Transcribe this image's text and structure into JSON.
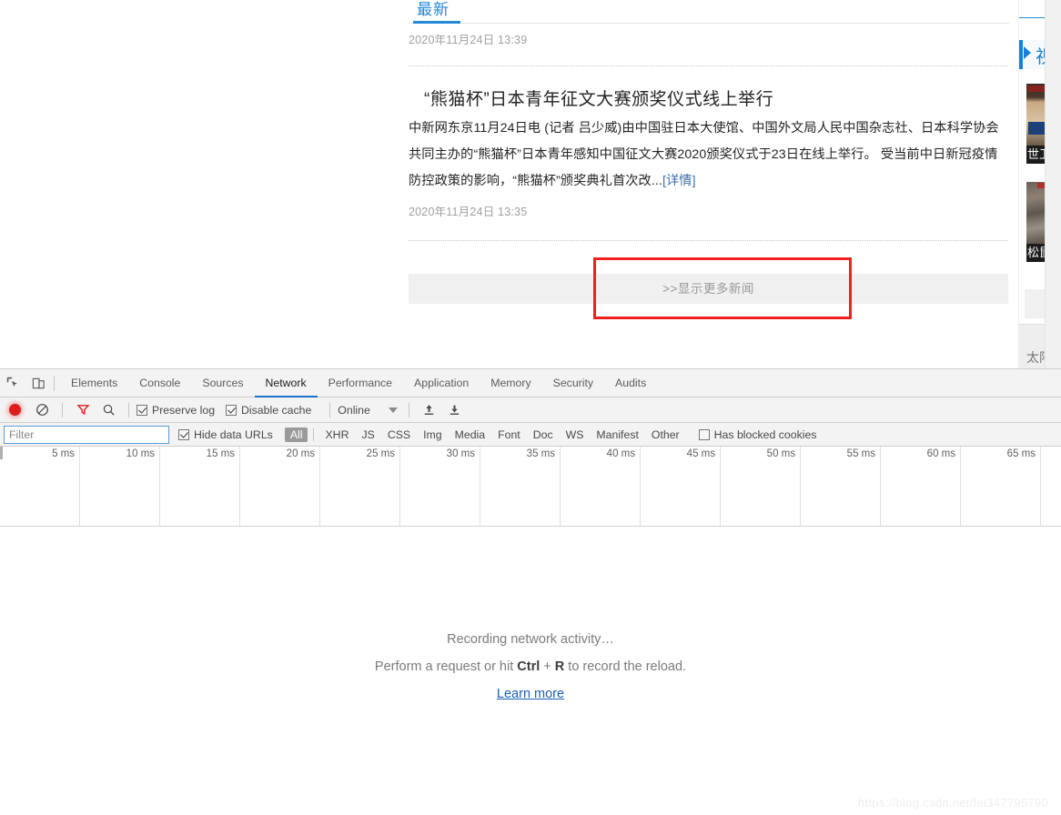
{
  "page": {
    "tab": {
      "label": "最新"
    },
    "entries": [
      {
        "timestamp": "2020年11月24日 13:39"
      }
    ],
    "article": {
      "headline": "“熊猫杯”日本青年征文大赛颁奖仪式线上举行",
      "body": "中新网东京11月24日电 (记者 吕少威)由中国驻日本大使馆、中国外文局人民中国杂志社、日本科学协会共同主办的“熊猫杯”日本青年感知中国征文大赛2020颁奖仪式于23日在线上举行。 受当前中日新冠疫情防控政策的影响，“熊猫杯”颁奖典礼首次改...",
      "detail_link": "[详情]",
      "timestamp": "2020年11月24日 13:35"
    },
    "more_button": {
      "label": ">>显示更多新闻"
    },
    "right_rail": {
      "section_label": "视",
      "thumbnails": [
        {
          "caption": "世卫"
        },
        {
          "caption": "松鼠"
        }
      ],
      "bottom_label": "太阳"
    }
  },
  "devtools": {
    "tabs": [
      {
        "label": "Elements",
        "active": false
      },
      {
        "label": "Console",
        "active": false
      },
      {
        "label": "Sources",
        "active": false
      },
      {
        "label": "Network",
        "active": true
      },
      {
        "label": "Performance",
        "active": false
      },
      {
        "label": "Application",
        "active": false
      },
      {
        "label": "Memory",
        "active": false
      },
      {
        "label": "Security",
        "active": false
      },
      {
        "label": "Audits",
        "active": false
      }
    ],
    "toolbar": {
      "record_title": "record",
      "clear_title": "clear",
      "filter_title": "filter",
      "search_title": "search",
      "preserve_log": {
        "label": "Preserve log",
        "checked": true
      },
      "disable_cache": {
        "label": "Disable cache",
        "checked": true
      },
      "throttling": {
        "value": "Online"
      },
      "import_title": "import-har",
      "export_title": "export-har"
    },
    "filterbar": {
      "filter_placeholder": "Filter",
      "filter_value": "",
      "hide_data_urls": {
        "label": "Hide data URLs",
        "checked": true
      },
      "types": [
        {
          "label": "All",
          "selected": true
        },
        {
          "label": "XHR",
          "selected": false
        },
        {
          "label": "JS",
          "selected": false
        },
        {
          "label": "CSS",
          "selected": false
        },
        {
          "label": "Img",
          "selected": false
        },
        {
          "label": "Media",
          "selected": false
        },
        {
          "label": "Font",
          "selected": false
        },
        {
          "label": "Doc",
          "selected": false
        },
        {
          "label": "WS",
          "selected": false
        },
        {
          "label": "Manifest",
          "selected": false
        },
        {
          "label": "Other",
          "selected": false
        }
      ],
      "has_blocked_cookies": {
        "label": "Has blocked cookies",
        "checked": false
      }
    },
    "ruler": {
      "ticks": [
        "5 ms",
        "10 ms",
        "15 ms",
        "20 ms",
        "25 ms",
        "30 ms",
        "35 ms",
        "40 ms",
        "45 ms",
        "50 ms",
        "55 ms",
        "60 ms",
        "65 ms"
      ]
    },
    "empty_state": {
      "line1": "Recording network activity…",
      "line2_pre": "Perform a request or hit ",
      "line2_key1": "Ctrl",
      "line2_plus": " + ",
      "line2_key2": "R",
      "line2_post": " to record the reload.",
      "link": "Learn more"
    }
  },
  "watermark": "https://blog.csdn.net/fei347795790",
  "colors": {
    "accent_blue": "#2589d8",
    "devtools_active": "#1a73c8",
    "record_red": "#e01b1b",
    "highlight_red": "#f02020",
    "link_blue": "#1a5fb4"
  }
}
